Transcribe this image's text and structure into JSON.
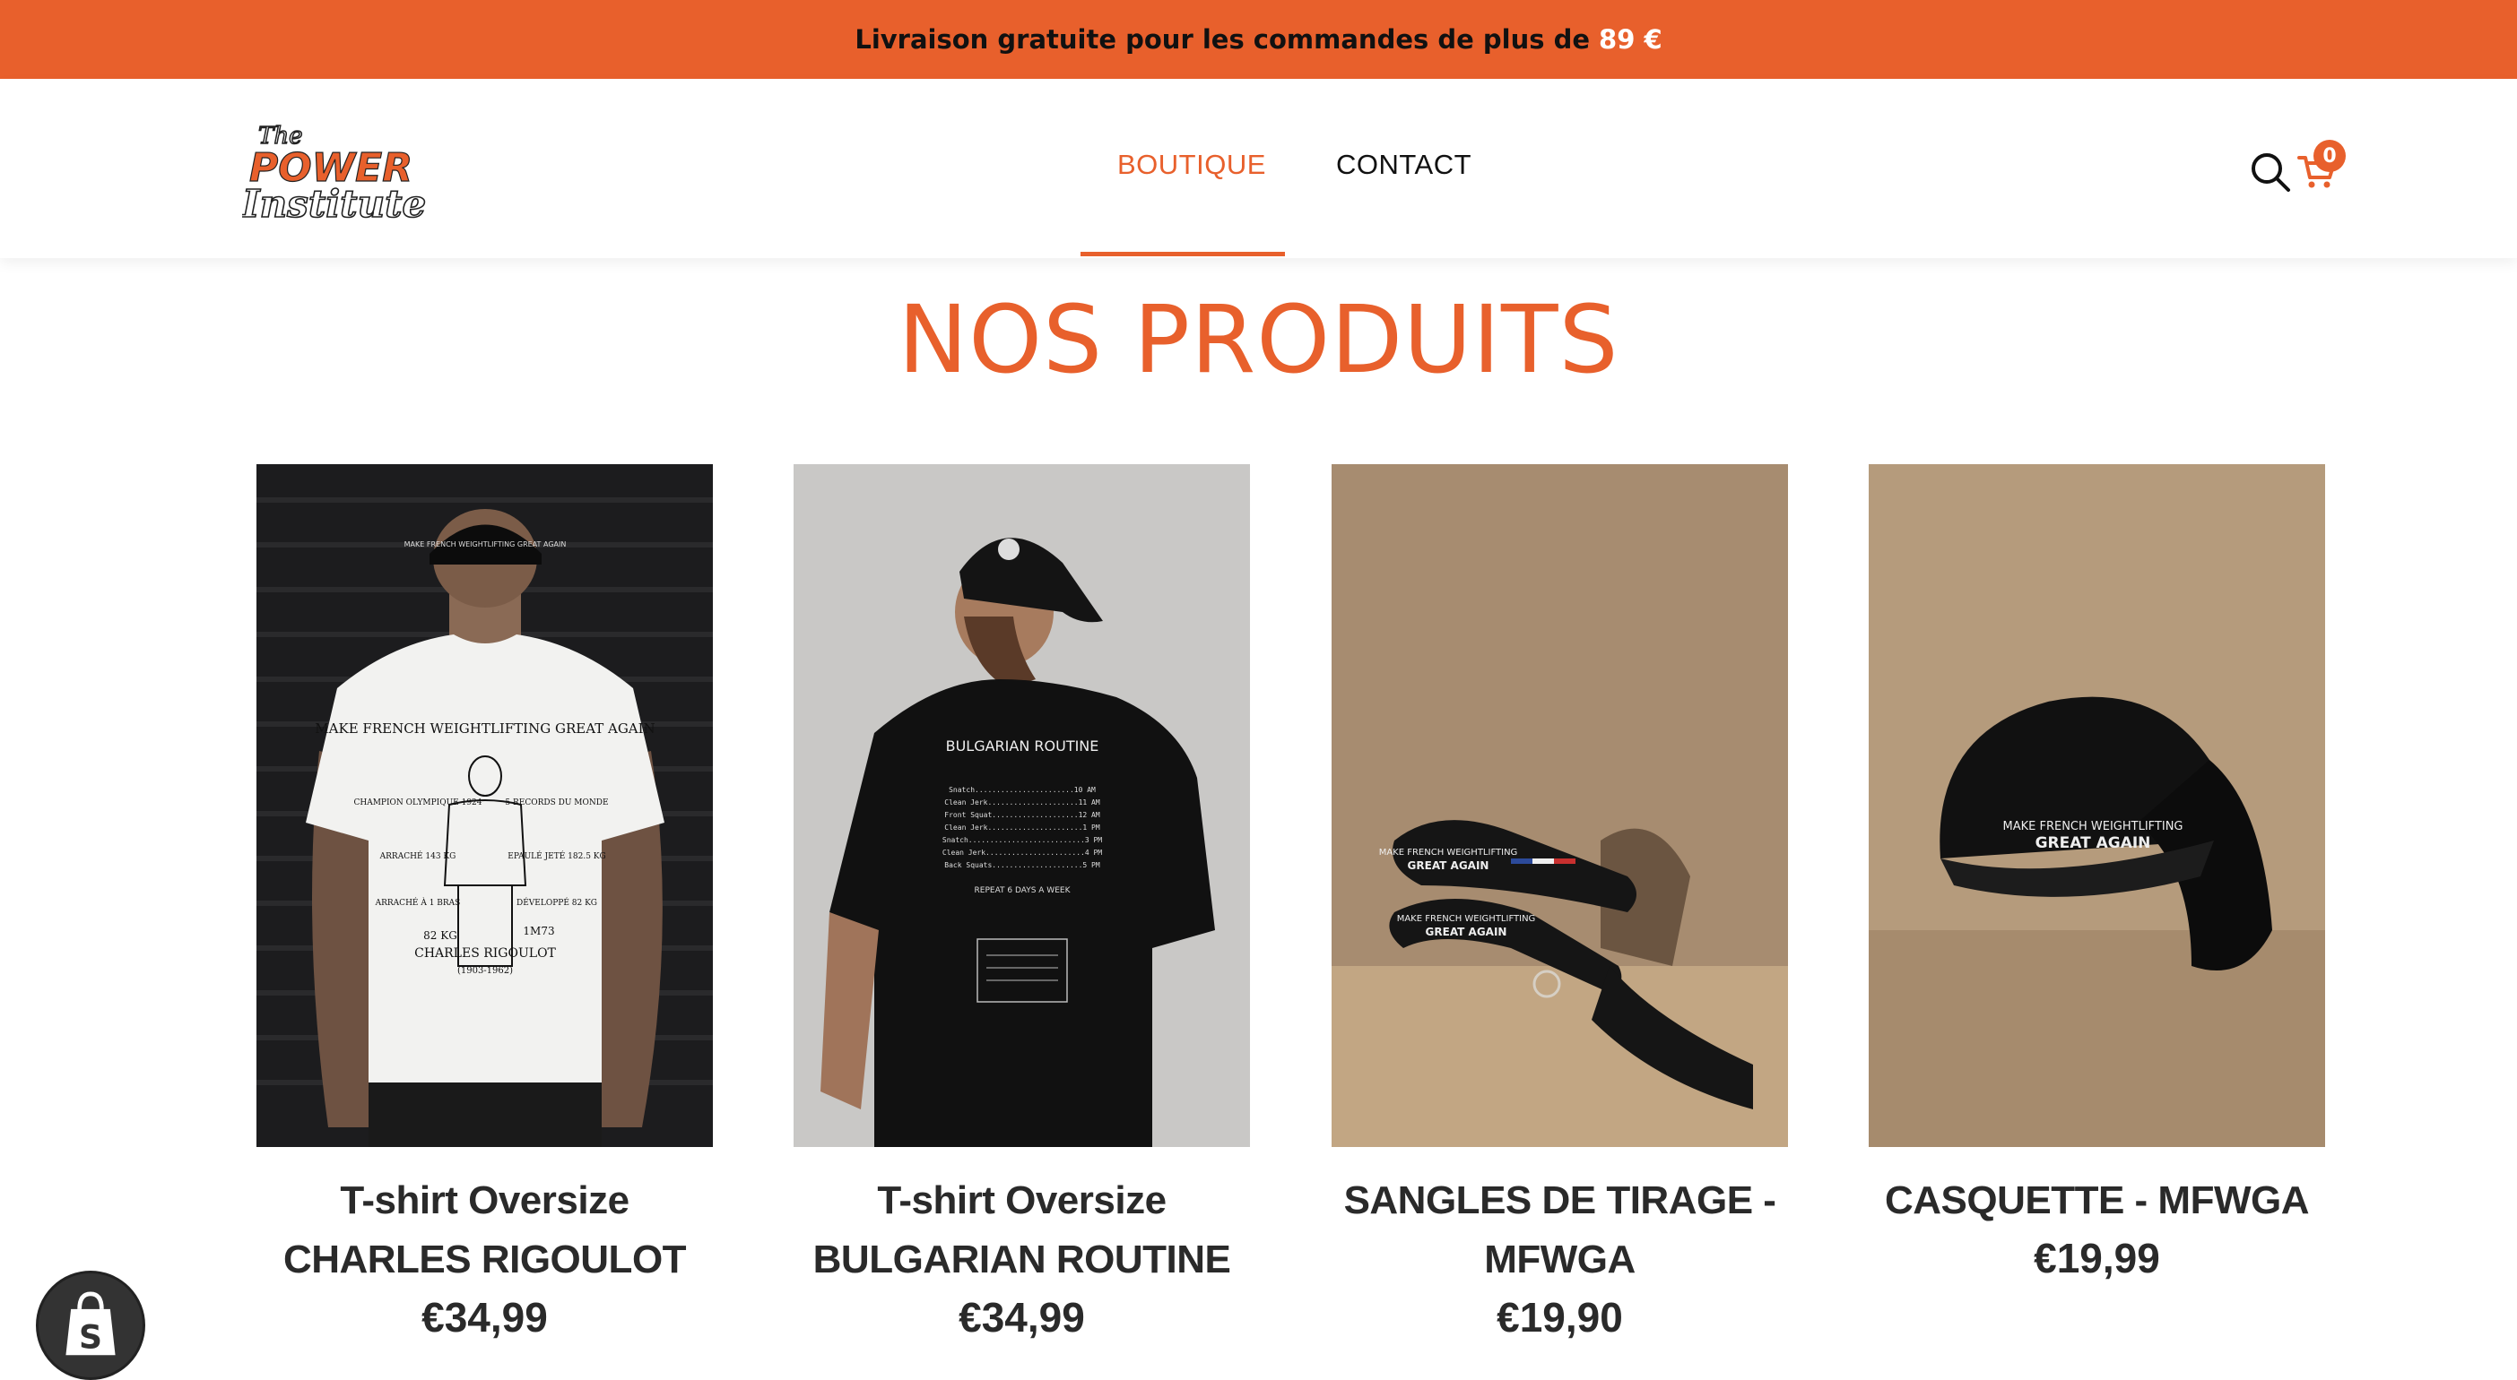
{
  "announcement": {
    "text": "Livraison gratuite pour les commandes de plus de",
    "amount": "89 €"
  },
  "brand": {
    "line1": "The",
    "line2": "POWER",
    "line3": "Institute"
  },
  "nav": {
    "items": [
      {
        "label": "BOUTIQUE",
        "active": true
      },
      {
        "label": "CONTACT",
        "active": false
      }
    ]
  },
  "cart": {
    "count": "0"
  },
  "section": {
    "title": "NOS PRODUITS"
  },
  "products": [
    {
      "name": "T-shirt Oversize CHARLES RIGOULOT",
      "price": "€34,99",
      "print_title": "MAKE FRENCH WEIGHTLIFTING GREAT AGAIN",
      "print_left_1": "CHAMPION OLYMPIQUE 1924",
      "print_right_1": "5 RECORDS DU MONDE",
      "print_left_2": "ARRACHÉ 143 KG",
      "print_right_2": "EPAULÉ JETÉ 182.5 KG",
      "print_left_3": "ARRACHÉ À 1 BRAS",
      "print_right_3": "DÉVELOPPÉ 82 KG",
      "print_weight": "82 KG",
      "print_height": "1M73",
      "print_name": "CHARLES RIGOULOT",
      "print_years": "(1903-1962)",
      "cap_text": "MAKE FRENCH WEIGHTLIFTING GREAT AGAIN"
    },
    {
      "name": "T-shirt Oversize BULGARIAN ROUTINE",
      "price": "€34,99",
      "print_title": "BULGARIAN ROUTINE",
      "print_lines": [
        "Snatch.......................10 AM",
        "Clean Jerk.....................11 AM",
        "Front Squat....................12 AM",
        "Clean Jerk......................1 PM",
        "Snatch...........................3 PM",
        "Clean Jerk.......................4 PM",
        "Back Squats.....................5 PM"
      ],
      "print_footer": "REPEAT 6 DAYS A WEEK"
    },
    {
      "name": "SANGLES DE TIRAGE - MFWGA",
      "price": "€19,90",
      "strap_text_1": "MAKE FRENCH WEIGHTLIFTING",
      "strap_text_2": "GREAT AGAIN"
    },
    {
      "name": "CASQUETTE - MFWGA",
      "price": "€19,99",
      "cap_line1": "MAKE FRENCH WEIGHTLIFTING",
      "cap_line2": "GREAT AGAIN"
    }
  ],
  "colors": {
    "accent": "#e8602c",
    "text": "#2a2a2a",
    "background": "#ffffff"
  }
}
